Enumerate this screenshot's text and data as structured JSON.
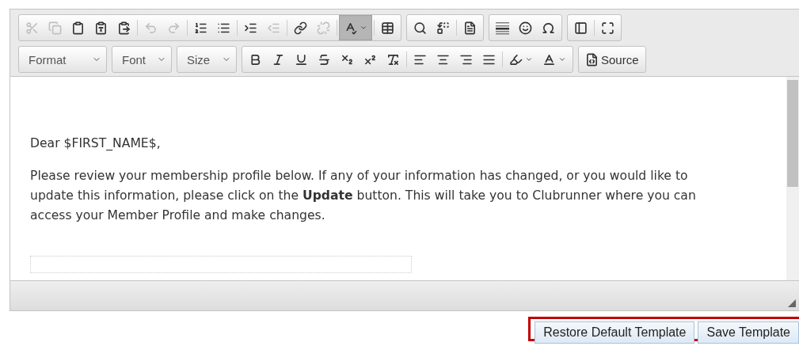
{
  "toolbar": {
    "rows": [
      [
        [
          {
            "kind": "cut",
            "disabled": true
          },
          {
            "kind": "copy",
            "disabled": true
          },
          {
            "kind": "paste",
            "disabled": false
          },
          {
            "kind": "paste_text",
            "disabled": false
          },
          {
            "kind": "paste_word",
            "disabled": false
          },
          {
            "kind": "separator"
          },
          {
            "kind": "undo",
            "disabled": true
          },
          {
            "kind": "redo",
            "disabled": true
          },
          {
            "kind": "separator"
          },
          {
            "kind": "numbered_list",
            "disabled": false
          },
          {
            "kind": "bulleted_list",
            "disabled": false
          },
          {
            "kind": "separator"
          },
          {
            "kind": "indent",
            "disabled": false
          },
          {
            "kind": "outdent",
            "disabled": true
          },
          {
            "kind": "separator"
          },
          {
            "kind": "link",
            "disabled": false
          },
          {
            "kind": "unlink",
            "disabled": true
          },
          {
            "kind": "separator"
          },
          {
            "kind": "spellcheck",
            "disabled": false,
            "pressed": true
          },
          {
            "kind": "separator"
          },
          {
            "kind": "table",
            "disabled": false
          }
        ],
        [
          {
            "kind": "find",
            "disabled": false
          },
          {
            "kind": "replace",
            "disabled": false
          },
          {
            "kind": "separator"
          },
          {
            "kind": "templates",
            "disabled": false
          }
        ],
        [
          {
            "kind": "horizontal_rule",
            "disabled": false
          },
          {
            "kind": "smiley",
            "disabled": false
          },
          {
            "kind": "special_char",
            "disabled": false
          }
        ],
        [
          {
            "kind": "show_blocks",
            "disabled": false
          },
          {
            "kind": "separator"
          },
          {
            "kind": "maximize",
            "disabled": false
          }
        ]
      ],
      [
        [
          {
            "kind": "combo",
            "label": "Format"
          }
        ],
        [
          {
            "kind": "combo",
            "label": "Font"
          }
        ],
        [
          {
            "kind": "combo",
            "label": "Size"
          }
        ],
        [
          {
            "kind": "bold",
            "disabled": false
          },
          {
            "kind": "italic",
            "disabled": false
          },
          {
            "kind": "underline",
            "disabled": false
          },
          {
            "kind": "strike",
            "disabled": false
          },
          {
            "kind": "subscript",
            "disabled": false
          },
          {
            "kind": "superscript",
            "disabled": false
          },
          {
            "kind": "remove_format",
            "disabled": false
          },
          {
            "kind": "separator"
          },
          {
            "kind": "align_left",
            "disabled": false
          },
          {
            "kind": "align_center",
            "disabled": false
          },
          {
            "kind": "align_right",
            "disabled": false
          },
          {
            "kind": "justify",
            "disabled": false
          },
          {
            "kind": "separator"
          },
          {
            "kind": "bg_color",
            "disabled": false
          },
          {
            "kind": "text_color",
            "disabled": false
          }
        ],
        [
          {
            "kind": "source",
            "label": "Source",
            "disabled": false
          }
        ]
      ]
    ]
  },
  "content": {
    "paragraphs": [
      "Dear $FIRST_NAME$,",
      "Please review your membership profile below. If any of your information has changed, or you would like to update this information, please click on the **Update** button. This will take you to Clubrunner where you can access your Member Profile and make changes."
    ]
  },
  "buttons": [
    {
      "label": "Restore Default Template"
    },
    {
      "label": "Save Template"
    }
  ]
}
